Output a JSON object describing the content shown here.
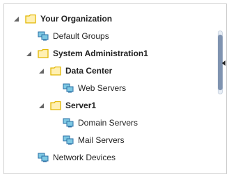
{
  "tree": {
    "nodes": [
      {
        "label": "Your Organization",
        "type": "folder",
        "expanded": true,
        "bold": true
      },
      {
        "label": "Default Groups",
        "type": "computer-group",
        "bold": false
      },
      {
        "label": "System Administration1",
        "type": "folder",
        "expanded": true,
        "bold": true
      },
      {
        "label": "Data Center",
        "type": "folder",
        "expanded": true,
        "bold": true
      },
      {
        "label": "Web Servers",
        "type": "computer-group",
        "bold": false
      },
      {
        "label": "Server1",
        "type": "folder",
        "expanded": true,
        "bold": true
      },
      {
        "label": "Domain Servers",
        "type": "computer-group",
        "bold": false
      },
      {
        "label": "Mail Servers",
        "type": "computer-group",
        "bold": false
      },
      {
        "label": "Network Devices",
        "type": "computer-group",
        "bold": false
      }
    ]
  },
  "icons": {
    "expander": "triangle-expanded-icon",
    "folder": "folder-icon",
    "computer_group": "computer-group-icon"
  },
  "colors": {
    "folder_fill": "#fff0b3",
    "folder_stroke": "#e2b600",
    "monitor_fill": "#7ec8e3",
    "monitor_stroke": "#2a6fa6",
    "expander": "#666666",
    "scroll_thumb": "#7f93b0"
  }
}
